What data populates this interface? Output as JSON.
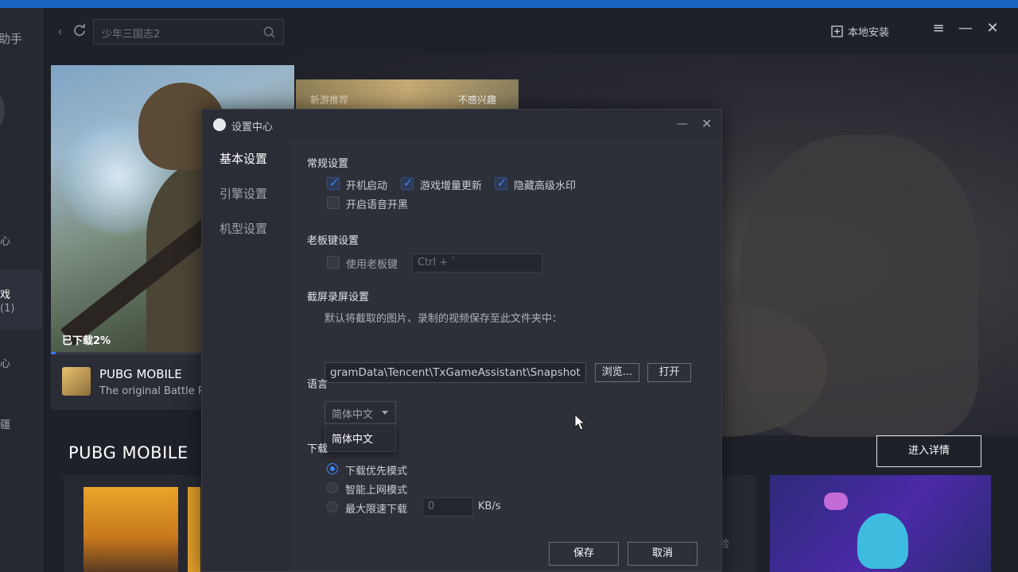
{
  "app": {
    "brand_partial": "助手",
    "search_placeholder": "少年三国志2",
    "local_install": "本地安装"
  },
  "sidebar": {
    "items": [
      {
        "label": "心"
      },
      {
        "label": "戏"
      },
      {
        "label": "(1)"
      },
      {
        "label": "心"
      },
      {
        "label": "疆"
      }
    ]
  },
  "banner": {
    "tag_new": "新游推荐",
    "tag_dislike": "不感兴趣"
  },
  "game_card": {
    "progress_label": "已下载2%",
    "progress_percent": 2,
    "title": "PUBG MOBILE",
    "subtitle": "The original Battle R"
  },
  "main": {
    "section_title": "PUBG MOBILE",
    "enter_detail": "进入详情",
    "bg_text": "险"
  },
  "dialog": {
    "title": "设置中心",
    "nav": [
      "基本设置",
      "引擎设置",
      "机型设置"
    ],
    "general": {
      "title": "常规设置",
      "options": [
        {
          "label": "开机启动",
          "checked": true
        },
        {
          "label": "游戏增量更新",
          "checked": true
        },
        {
          "label": "隐藏高级水印",
          "checked": true
        },
        {
          "label": "开启语音开黑",
          "checked": false
        }
      ]
    },
    "boss_key": {
      "title": "老板键设置",
      "option": "使用老板键",
      "checked": false,
      "hotkey": "Ctrl + `"
    },
    "screenshot": {
      "title": "截屏录屏设置",
      "desc": "默认将截取的图片、录制的视频保存至此文件夹中：",
      "path": "gramData\\Tencent\\TxGameAssistant\\Snapshot",
      "browse": "浏览...",
      "open": "打开"
    },
    "language": {
      "title": "语言",
      "selected": "简体中文",
      "options": [
        "简体中文"
      ]
    },
    "download": {
      "title_partial": "下载",
      "modes": [
        {
          "label": "下载优先模式",
          "selected": true
        },
        {
          "label": "智能上网模式",
          "selected": false
        },
        {
          "label": "最大限速下载",
          "selected": false
        }
      ],
      "speed_value": "0",
      "speed_unit": "KB/s"
    },
    "save": "保存",
    "cancel": "取消"
  },
  "colors": {
    "accent": "#3d86ff",
    "titlebar_strip": "#1565c0",
    "background": "#1f2129",
    "dialog": "#2e3039"
  }
}
